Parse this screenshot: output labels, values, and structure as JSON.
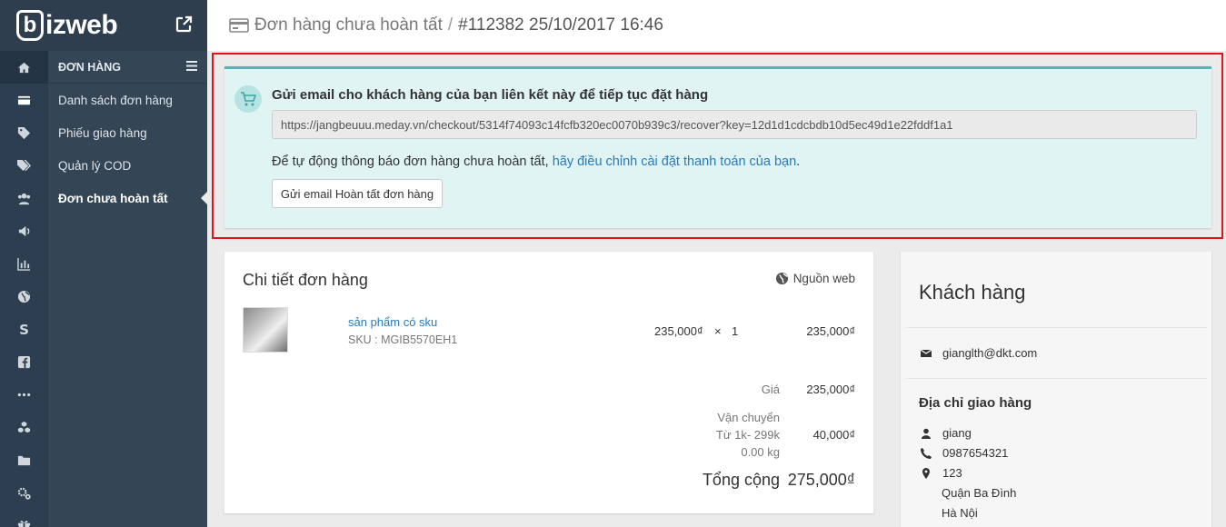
{
  "brand": {
    "logo_letter": "b",
    "logo_text": "izweb"
  },
  "rail": {
    "icons": [
      "home-icon",
      "card-icon",
      "tag-icon",
      "tags-icon",
      "users-icon",
      "megaphone-icon",
      "bar-chart-icon",
      "globe-icon",
      "s-icon",
      "facebook-icon",
      "more-icon",
      "cubes-icon",
      "folder-icon",
      "settings-icon",
      "gift-icon"
    ]
  },
  "submenu": {
    "heading": "ĐƠN HÀNG",
    "items": [
      {
        "label": "Danh sách đơn hàng"
      },
      {
        "label": "Phiếu giao hàng"
      },
      {
        "label": "Quản lý COD"
      },
      {
        "label": "Đơn chưa hoàn tất"
      }
    ]
  },
  "header": {
    "section": "Đơn hàng chưa hoàn tất",
    "separator": "/",
    "order": "#112382 25/10/2017 16:46"
  },
  "notice": {
    "title": "Gửi email cho khách hàng của bạn liên kết này để tiếp tục đặt hàng",
    "recover_url": "https://jangbeuuu.meday.vn/checkout/5314f74093c14fcfb320ec0070b939c3/recover?key=12d1d1cdcbdb10d5ec49d1e22fddf1a1",
    "auto_text": "Để tự động thông báo đơn hàng chưa hoàn tất,",
    "auto_link": "hãy điều chỉnh cài đặt thanh toán của bạn",
    "auto_end": ".",
    "button": "Gửi email Hoàn tất đơn hàng"
  },
  "order": {
    "title": "Chi tiết đơn hàng",
    "source": "Nguồn web",
    "item": {
      "name": "sản phẩm có sku",
      "sku": "SKU : MGIB5570EH1",
      "unit_price": "235,000₫",
      "times": "×",
      "qty": "1",
      "total": "235,000₫"
    },
    "price_label": "Giá",
    "price_value": "235,000₫",
    "shipping_label_1": "Vận chuyển",
    "shipping_label_2": "Từ 1k- 299k",
    "shipping_label_3": "0.00 kg",
    "shipping_value": "40,000₫",
    "total_label": "Tổng cộng",
    "total_value": "275,000₫"
  },
  "customer": {
    "title": "Khách hàng",
    "email": "gianglth@dkt.com",
    "address_title": "Địa chỉ giao hàng",
    "name": "giang",
    "phone": "0987654321",
    "address_1": "123",
    "address_2": "Quận Ba Đình",
    "address_3": "Hà Nội"
  },
  "colors": {
    "sidebar": "#2c3e50",
    "submenu": "#344556",
    "notice_bg": "#e0f4f4",
    "notice_accent": "#4fb7b4",
    "highlight": "#e2131a",
    "link": "#2a7ab8"
  }
}
